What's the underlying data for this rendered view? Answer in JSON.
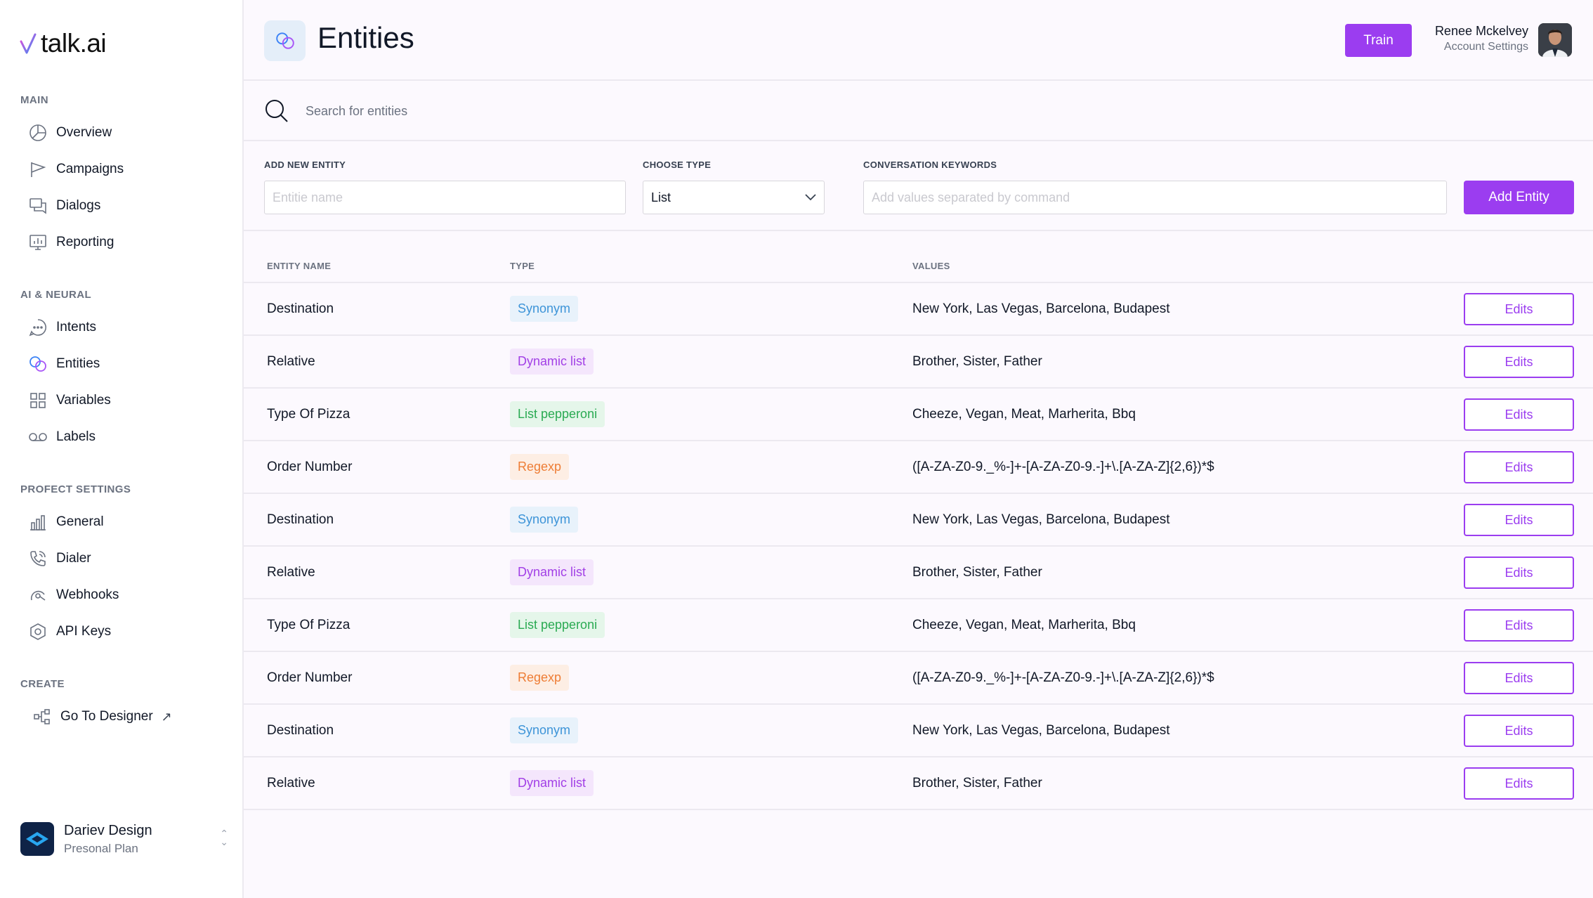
{
  "app": {
    "logo_text": "talk.ai"
  },
  "sidebar": {
    "sections": [
      {
        "title": "MAIN",
        "items": [
          {
            "label": "Overview",
            "icon": "pie-chart-icon"
          },
          {
            "label": "Campaigns",
            "icon": "flag-icon"
          },
          {
            "label": "Dialogs",
            "icon": "chat-bubbles-icon"
          },
          {
            "label": "Reporting",
            "icon": "report-chart-icon"
          }
        ]
      },
      {
        "title": "AI & NEURAL",
        "items": [
          {
            "label": "Intents",
            "icon": "chat-dots-icon"
          },
          {
            "label": "Entities",
            "icon": "linked-circles-icon",
            "active": true
          },
          {
            "label": "Variables",
            "icon": "grid-icon"
          },
          {
            "label": "Labels",
            "icon": "voicemail-icon"
          }
        ]
      },
      {
        "title": "PROFECT SETTINGS",
        "items": [
          {
            "label": "General",
            "icon": "bar-chart-icon"
          },
          {
            "label": "Dialer",
            "icon": "phone-icon"
          },
          {
            "label": "Webhooks",
            "icon": "webhook-icon"
          },
          {
            "label": "API Keys",
            "icon": "hexagon-icon"
          }
        ]
      },
      {
        "title": "CREATE",
        "items": [
          {
            "label": "Go To Designer",
            "icon": "flow-icon",
            "external": true
          }
        ]
      }
    ],
    "workspace": {
      "name": "Dariev Design",
      "plan": "Presonal Plan"
    }
  },
  "header": {
    "title": "Entities",
    "train_label": "Train",
    "user_name": "Renee Mckelvey",
    "user_sub": "Account Settings"
  },
  "search": {
    "placeholder": "Search for entities"
  },
  "form": {
    "name_label": "ADD NEW ENTITY",
    "name_placeholder": "Entitie name",
    "type_label": "CHOOSE TYPE",
    "type_value": "List",
    "keywords_label": "CONVERSATION KEYWORDS",
    "keywords_placeholder": "Add values separated by command",
    "add_label": "Add Entity"
  },
  "table": {
    "columns": [
      "ENTITY NAME",
      "TYPE",
      "VALUES"
    ],
    "edit_label": "Edits",
    "rows": [
      {
        "name": "Destination",
        "type": "Synonym",
        "kind": "synonym",
        "values": "New York, Las Vegas, Barcelona, Budapest"
      },
      {
        "name": "Relative",
        "type": "Dynamic list",
        "kind": "dynamic",
        "values": "Brother, Sister, Father"
      },
      {
        "name": "Type Of Pizza",
        "type": "List pepperoni",
        "kind": "list",
        "values": "Cheeze, Vegan, Meat, Marherita, Bbq"
      },
      {
        "name": "Order Number",
        "type": "Regexp",
        "kind": "regexp",
        "values": "([A-ZA-Z0-9._%-]+-[A-ZA-Z0-9.-]+\\.[A-ZA-Z]{2,6})*$"
      },
      {
        "name": "Destination",
        "type": "Synonym",
        "kind": "synonym",
        "values": "New York, Las Vegas, Barcelona, Budapest"
      },
      {
        "name": "Relative",
        "type": "Dynamic list",
        "kind": "dynamic",
        "values": "Brother, Sister, Father"
      },
      {
        "name": "Type Of Pizza",
        "type": "List pepperoni",
        "kind": "list",
        "values": "Cheeze, Vegan, Meat, Marherita, Bbq"
      },
      {
        "name": "Order Number",
        "type": "Regexp",
        "kind": "regexp",
        "values": "([A-ZA-Z0-9._%-]+-[A-ZA-Z0-9.-]+\\.[A-ZA-Z]{2,6})*$"
      },
      {
        "name": "Destination",
        "type": "Synonym",
        "kind": "synonym",
        "values": "New York, Las Vegas, Barcelona, Budapest"
      },
      {
        "name": "Relative",
        "type": "Dynamic list",
        "kind": "dynamic",
        "values": "Brother, Sister, Father"
      }
    ]
  },
  "colors": {
    "accent": "#9b3df0",
    "synonym": "#3d94d8",
    "dynamic": "#a23fe6",
    "list": "#2aaa52",
    "regexp": "#ee7d35"
  }
}
